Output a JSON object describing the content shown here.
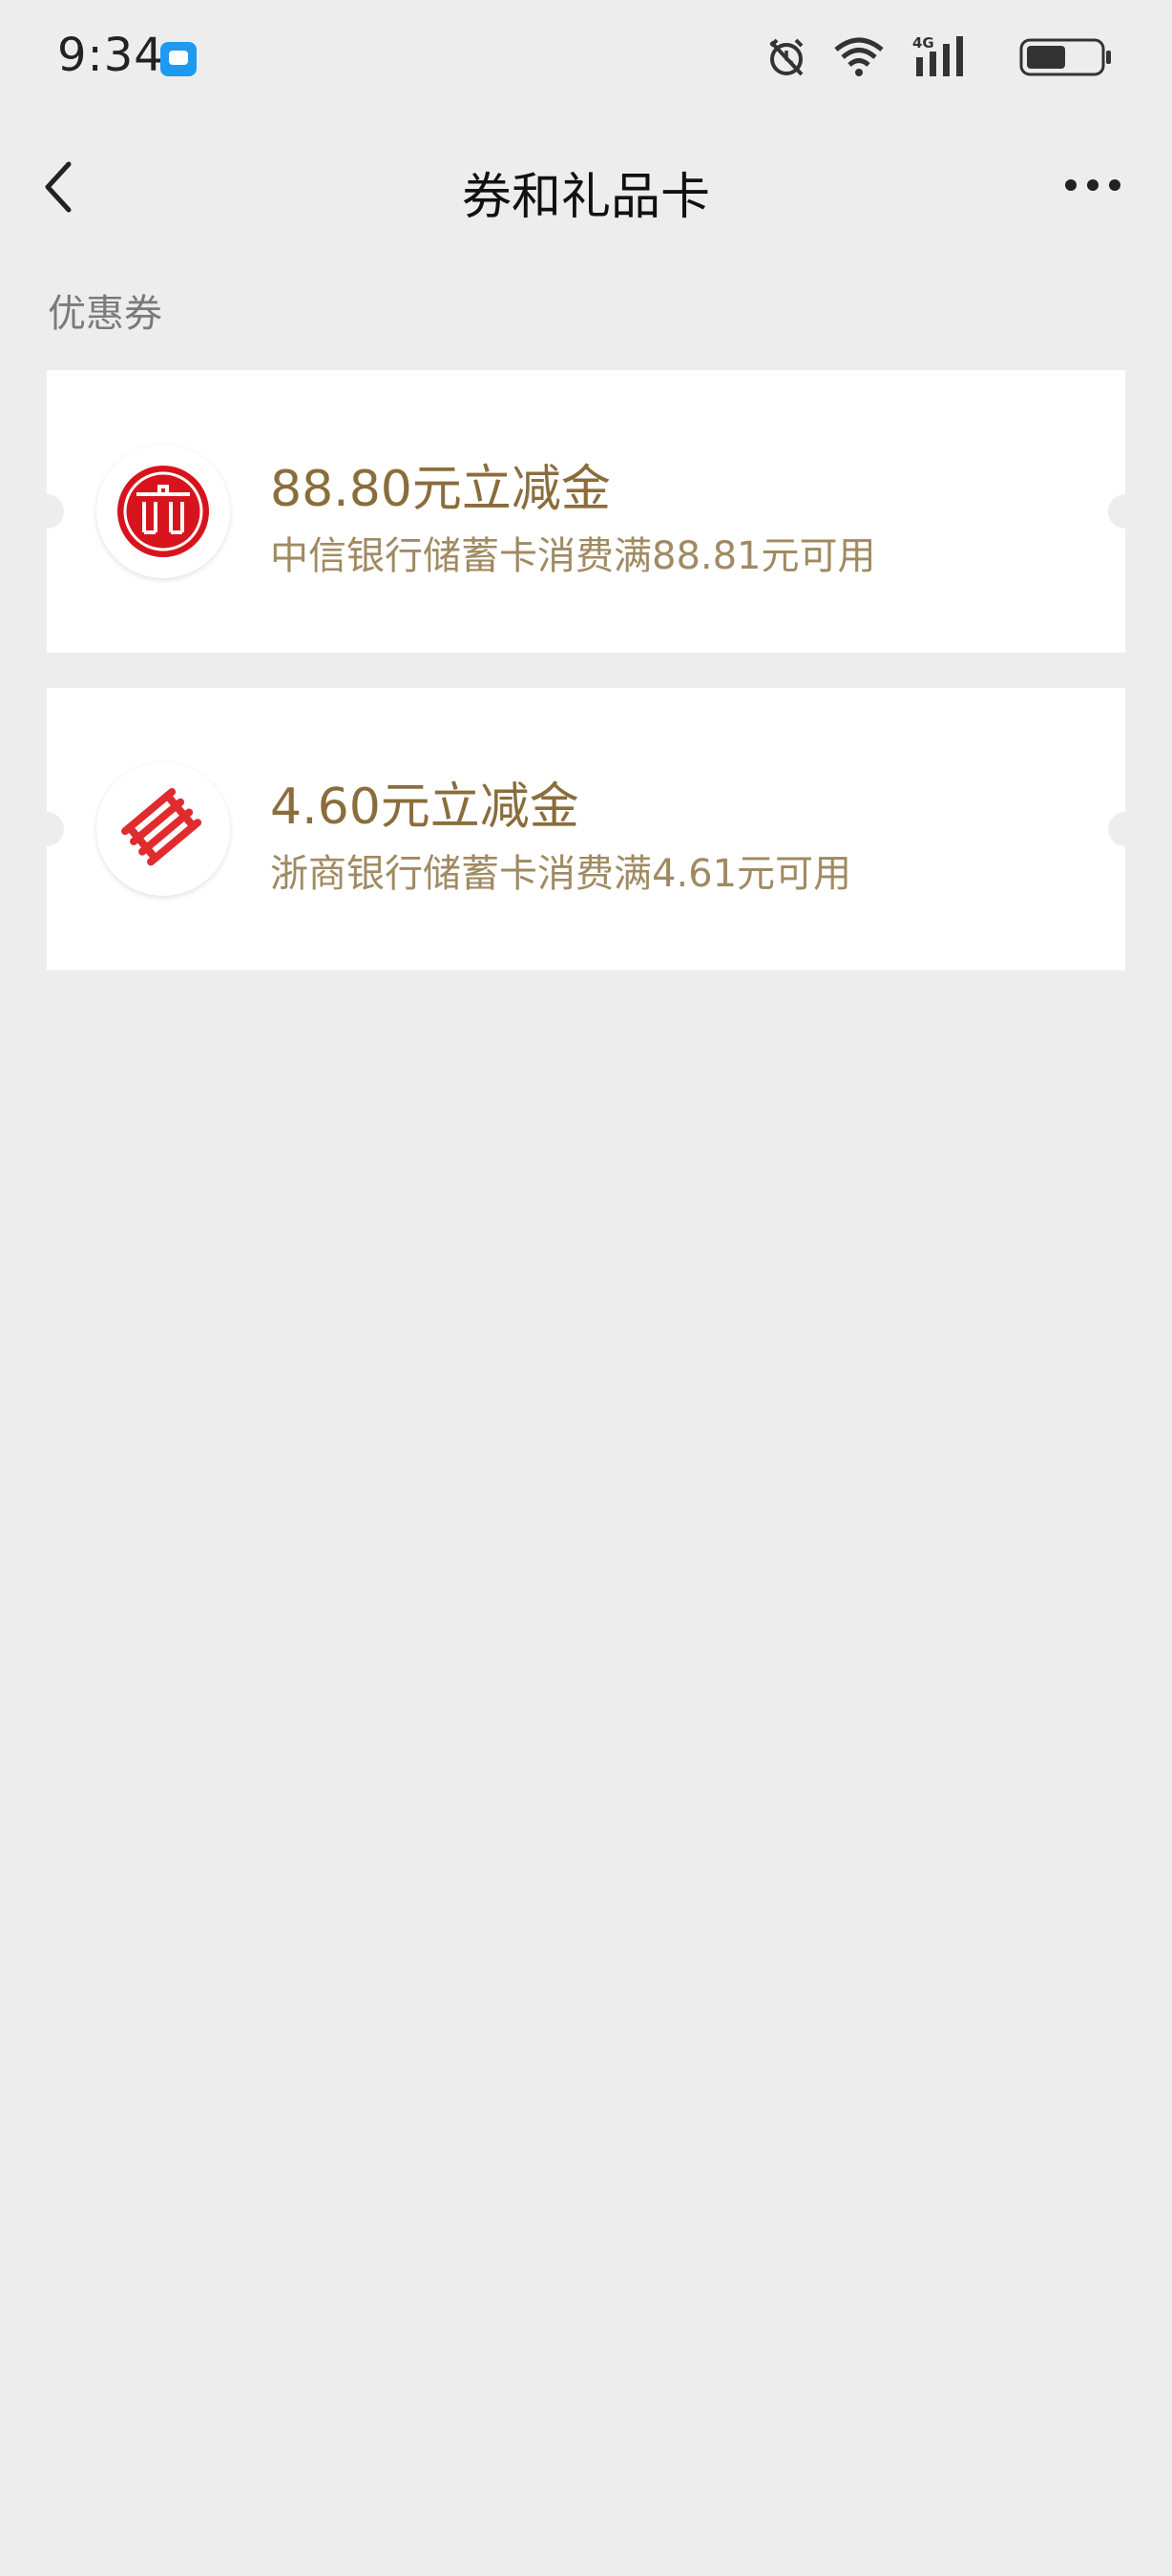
{
  "status_bar": {
    "time": "9:34",
    "icons": [
      "chat-notification-icon",
      "alarm-icon",
      "wifi-icon",
      "4g-signal-icon",
      "battery-icon"
    ],
    "network_label": "4G"
  },
  "nav": {
    "title": "券和礼品卡"
  },
  "section": {
    "label": "优惠券"
  },
  "coupons": [
    {
      "title": "88.80元立减金",
      "desc": "中信银行储蓄卡消费满88.81元可用",
      "logo": "citic-bank-logo",
      "logo_color": "#d7141d"
    },
    {
      "title": "4.60元立减金",
      "desc": "浙商银行储蓄卡消费满4.61元可用",
      "logo": "czbank-logo",
      "logo_color": "#e02b2f"
    }
  ],
  "colors": {
    "background": "#ededed",
    "coupon_title": "#8a6d3b",
    "coupon_desc": "#a08a62",
    "notification_icon": "#1e9bf0"
  }
}
